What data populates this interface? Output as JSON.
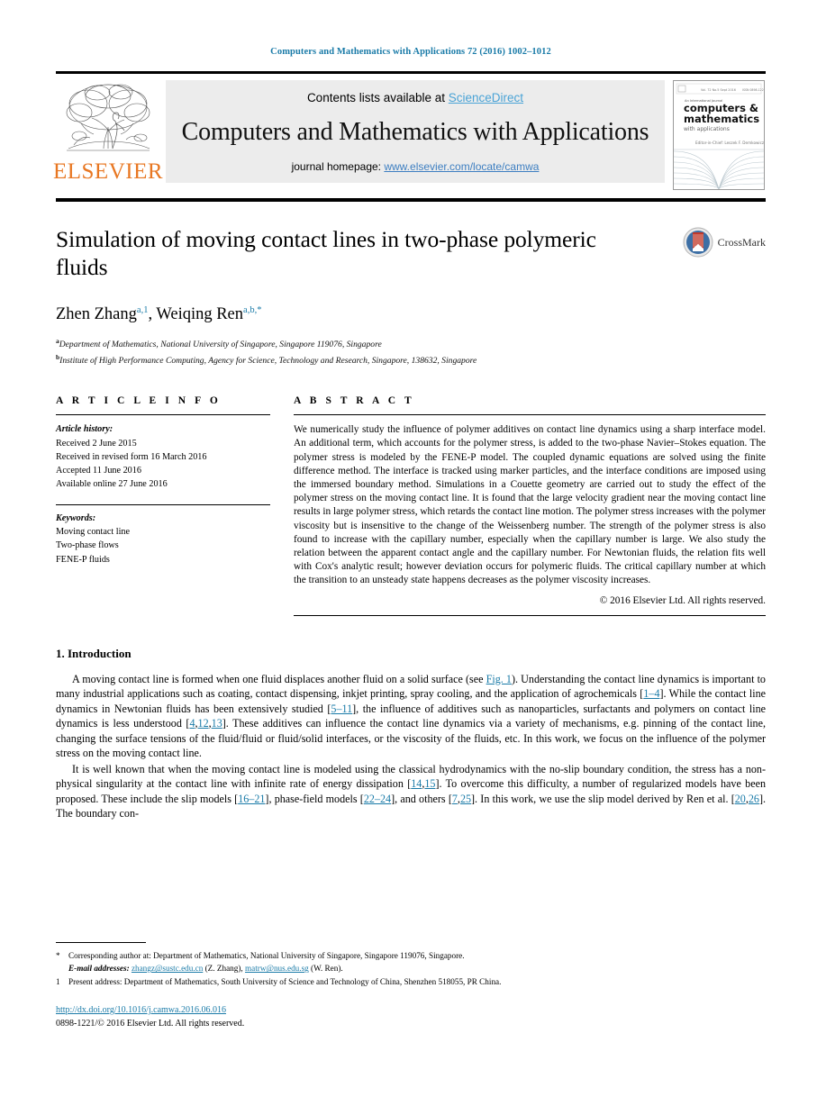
{
  "running_head": "Computers and Mathematics with Applications 72 (2016) 1002–1012",
  "masthead": {
    "publisher_name": "ELSEVIER",
    "contents_prefix": "Contents lists available at ",
    "sciencedirect": "ScienceDirect",
    "journal_title": "Computers and Mathematics with Applications",
    "homepage_prefix": "journal homepage: ",
    "homepage_url": "www.elsevier.com/locate/camwa",
    "cover_journal_line1": "computers &",
    "cover_journal_line2": "mathematics",
    "cover_journal_line3": "with applications",
    "accent_color": "#4aa3d6",
    "brand_color": "#E87722"
  },
  "article": {
    "title": "Simulation of moving contact lines in two-phase polymeric fluids",
    "crossmark_label": "CrossMark",
    "authors": [
      {
        "name": "Zhen Zhang",
        "sup": "a,1"
      },
      {
        "name": "Weiqing Ren",
        "sup": "a,b,*"
      }
    ],
    "affiliations": [
      {
        "marker": "a",
        "text": "Department of Mathematics, National University of Singapore, Singapore 119076, Singapore"
      },
      {
        "marker": "b",
        "text": "Institute of High Performance Computing, Agency for Science, Technology and Research, Singapore, 138632, Singapore"
      }
    ]
  },
  "info": {
    "heading": "A R T I C L E   I N F O",
    "history_label": "Article history:",
    "history": [
      "Received 2 June 2015",
      "Received in revised form 16 March 2016",
      "Accepted 11 June 2016",
      "Available online 27 June 2016"
    ],
    "keywords_label": "Keywords:",
    "keywords": [
      "Moving contact line",
      "Two-phase flows",
      "FENE-P fluids"
    ]
  },
  "abstract": {
    "heading": "A B S T R A C T",
    "text": "We numerically study the influence of polymer additives on contact line dynamics using a sharp interface model. An additional term, which accounts for the polymer stress, is added to the two-phase Navier–Stokes equation. The polymer stress is modeled by the FENE-P model. The coupled dynamic equations are solved using the finite difference method. The interface is tracked using marker particles, and the interface conditions are imposed using the immersed boundary method. Simulations in a Couette geometry are carried out to study the effect of the polymer stress on the moving contact line. It is found that the large velocity gradient near the moving contact line results in large polymer stress, which retards the contact line motion. The polymer stress increases with the polymer viscosity but is insensitive to the change of the Weissenberg number. The strength of the polymer stress is also found to increase with the capillary number, especially when the capillary number is large. We also study the relation between the apparent contact angle and the capillary number. For Newtonian fluids, the relation fits well with Cox's analytic result; however deviation occurs for polymeric fluids. The critical capillary number at which the transition to an unsteady state happens decreases as the polymer viscosity increases.",
    "copyright": "© 2016 Elsevier Ltd. All rights reserved."
  },
  "introduction": {
    "heading": "1. Introduction",
    "paragraph_1": {
      "seg_1": "A moving contact line is formed when one fluid displaces another fluid on a solid surface (see ",
      "link_1": "Fig. 1",
      "seg_2": "). Understanding the contact line dynamics is important to many industrial applications such as coating, contact dispensing, inkjet printing, spray cooling, and the application of agrochemicals [",
      "link_2": "1–4",
      "seg_3": "]. While the contact line dynamics in Newtonian fluids has been extensively studied [",
      "link_3": "5–11",
      "seg_4": "], the influence of additives such as nanoparticles, surfactants and polymers on contact line dynamics is less understood [",
      "link_4": "4",
      "seg_5": ",",
      "link_5": "12",
      "seg_6": ",",
      "link_6": "13",
      "seg_7": "]. These additives can influence the contact line dynamics via a variety of mechanisms, e.g. pinning of the contact line, changing the surface tensions of the fluid/fluid or fluid/solid interfaces, or the viscosity of the fluids, etc. In this work, we focus on the influence of the polymer stress on the moving contact line."
    },
    "paragraph_2": {
      "seg_1": "It is well known that when the moving contact line is modeled using the classical hydrodynamics with the no-slip boundary condition, the stress has a non-physical singularity at the contact line with infinite rate of energy dissipation [",
      "link_1": "14",
      "seg_2": ",",
      "link_2": "15",
      "seg_3": "]. To overcome this difficulty, a number of regularized models have been proposed. These include the slip models [",
      "link_3": "16–21",
      "seg_4": "], phase-field models [",
      "link_4": "22–24",
      "seg_5": "], and others [",
      "link_5": "7",
      "seg_6": ",",
      "link_6": "25",
      "seg_7": "]. In this work, we use the slip model derived by Ren et al. [",
      "link_7": "20",
      "seg_8": ",",
      "link_8": "26",
      "seg_9": "]. The boundary con-"
    }
  },
  "footnotes": {
    "corresponding": {
      "marker": "*",
      "text": "Corresponding author at: Department of Mathematics, National University of Singapore, Singapore 119076, Singapore."
    },
    "email_label": "E-mail addresses:",
    "email_1": "zhangz@sustc.edu.cn",
    "email_1_who": " (Z. Zhang), ",
    "email_2": "matrw@nus.edu.sg",
    "email_2_who": " (W. Ren).",
    "present_address": {
      "marker": "1",
      "text": "Present address: Department of Mathematics, South University of Science and Technology of China, Shenzhen 518055, PR China."
    },
    "doi": "http://dx.doi.org/10.1016/j.camwa.2016.06.016",
    "issn": "0898-1221/© 2016 Elsevier Ltd. All rights reserved."
  }
}
